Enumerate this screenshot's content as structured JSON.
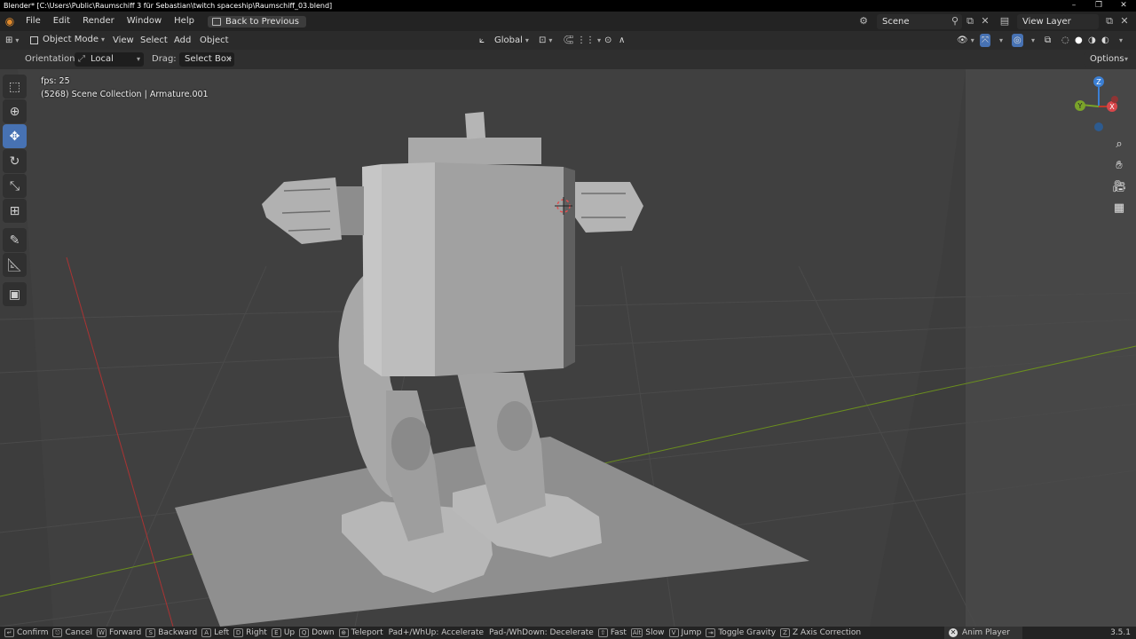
{
  "window": {
    "title": "Blender* [C:\\Users\\Public\\Raumschiff 3 für Sebastian\\twitch spaceship\\Raumschiff_03.blend]",
    "controls": [
      "–",
      "❐",
      "✕"
    ]
  },
  "menubar": {
    "items": [
      "File",
      "Edit",
      "Render",
      "Window",
      "Help"
    ],
    "back_button": "Back to Previous",
    "scene_label": "Scene",
    "view_layer_label": "View Layer"
  },
  "header": {
    "mode": "Object Mode",
    "menus": [
      "View",
      "Select",
      "Add",
      "Object"
    ],
    "transform_orientation": "Global"
  },
  "tool_settings": {
    "orientation_label": "Orientation:",
    "orientation_value": "Local",
    "drag_label": "Drag:",
    "drag_value": "Select Box",
    "options_label": "Options"
  },
  "toolbar": {
    "tools": [
      {
        "name": "select-box",
        "icon": "select-box-icon",
        "active": false
      },
      {
        "name": "cursor",
        "icon": "cursor-icon",
        "active": false
      },
      {
        "name": "move",
        "icon": "move-icon",
        "active": true
      },
      {
        "name": "rotate",
        "icon": "rotate-icon",
        "active": false
      },
      {
        "name": "scale",
        "icon": "scale-icon",
        "active": false
      },
      {
        "name": "transform",
        "icon": "transform-icon",
        "active": false
      },
      {
        "name": "annotate",
        "icon": "annotate-icon",
        "active": false
      },
      {
        "name": "measure",
        "icon": "measure-icon",
        "active": false
      },
      {
        "name": "add-cube",
        "icon": "add-cube-icon",
        "active": false
      }
    ]
  },
  "viewport": {
    "fps_text": "fps: 25",
    "collection_text": "(5268) Scene Collection | Armature.001",
    "gizmo_axes": {
      "x": "X",
      "y": "Y",
      "z": "Z"
    },
    "colors": {
      "background": "#3d3d3d",
      "x_axis": "#c0392b",
      "y_axis": "#7aa32a",
      "z_axis": "#3b7fd4"
    }
  },
  "statusbar": {
    "items": [
      {
        "key": "↵",
        "label": "Confirm"
      },
      {
        "key": "⎋",
        "label": "Cancel"
      },
      {
        "key": "W",
        "label": "Forward"
      },
      {
        "key": "S",
        "label": "Backward"
      },
      {
        "key": "A",
        "label": "Left"
      },
      {
        "key": "D",
        "label": "Right"
      },
      {
        "key": "E",
        "label": "Up"
      },
      {
        "key": "Q",
        "label": "Down"
      },
      {
        "key": "⊕",
        "label": "Teleport"
      },
      {
        "key": "",
        "label": "Pad+/WhUp: Accelerate"
      },
      {
        "key": "",
        "label": "Pad-/WhDown: Decelerate"
      },
      {
        "key": "⇧",
        "label": "Fast"
      },
      {
        "key": "Alt",
        "label": "Slow"
      },
      {
        "key": "V",
        "label": "Jump"
      },
      {
        "key": "⇥",
        "label": "Toggle Gravity"
      },
      {
        "key": "Z",
        "label": "Z Axis Correction"
      }
    ],
    "anim_player": "Anim Player",
    "version": "3.5.1"
  }
}
